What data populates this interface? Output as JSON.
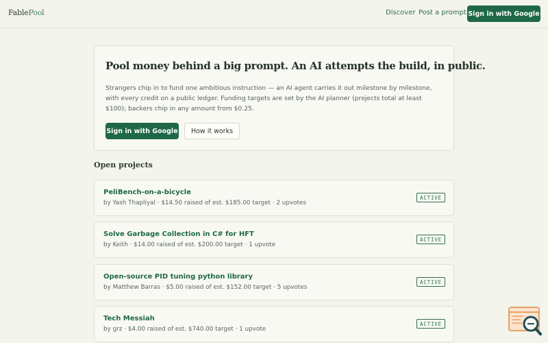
{
  "header": {
    "brand_part1": "Fable",
    "brand_part2": "Pool",
    "nav_discover": "Discover",
    "nav_post": "Post a prompt",
    "signin_label": "Sign in with Google"
  },
  "hero": {
    "title": "Pool money behind a big prompt. An AI attempts the build, in public.",
    "description": "Strangers chip in to fund one ambitious instruction — an AI agent carries it out milestone by milestone, with every credit on a public ledger. Funding targets are set by the AI planner (projects total at least $100); backers chip in any amount from $0.25.",
    "primary_button": "Sign in with Google",
    "secondary_button": "How it works"
  },
  "projects_section": {
    "title": "Open projects",
    "projects": [
      {
        "title": "PeliBench-on-a-bicycle",
        "meta": "by Yash Thapliyal · $14.50 raised of est. $185.00 target · 2 upvotes",
        "status": "ACTIVE"
      },
      {
        "title": "Solve Garbage Collection in C# for HFT",
        "meta": "by Keith · $14.00 raised of est. $200.00 target · 1 upvote",
        "status": "ACTIVE"
      },
      {
        "title": "Open-source PID tuning python library",
        "meta": "by Matthew Barras · $5.00 raised of est. $152.00 target · 5 upvotes",
        "status": "ACTIVE"
      },
      {
        "title": "Tech Messiah",
        "meta": "by grz · $4.00 raised of est. $740.00 target · 1 upvote",
        "status": "ACTIVE"
      }
    ]
  },
  "colors": {
    "accent": "#1f6847",
    "background": "#f3f4ec",
    "card": "#f8f9f3",
    "widget_orange": "#e8a064",
    "widget_teal": "#1d4f55"
  },
  "icons": {
    "helper_widget": "inspect-magnifier-icon"
  }
}
